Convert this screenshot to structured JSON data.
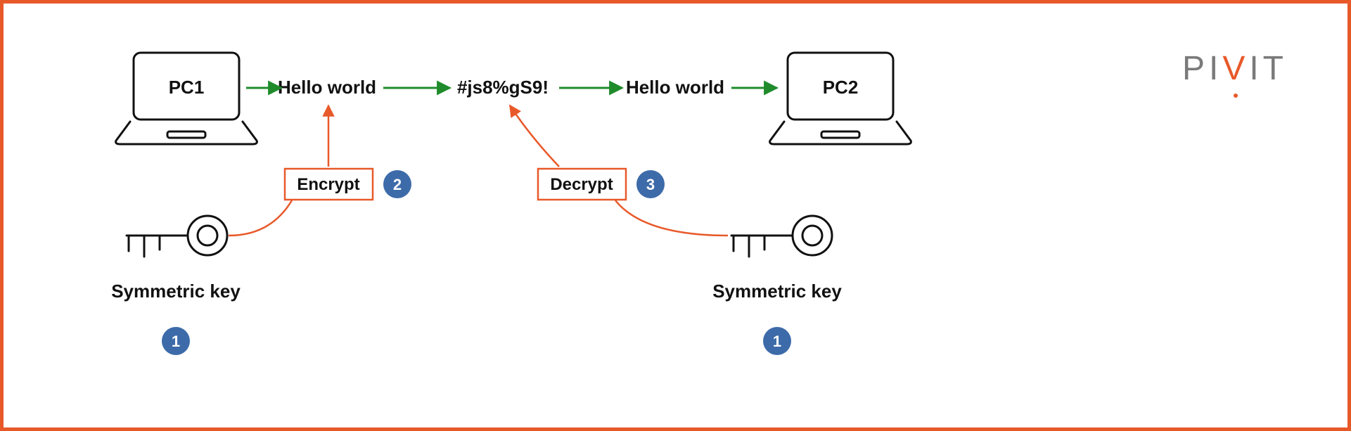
{
  "brand": {
    "p": "P",
    "i1": "I",
    "v": "V",
    "i2": "I",
    "t": "T"
  },
  "flow": {
    "pc1": "PC1",
    "plain1": "Hello world",
    "cipher": "#js8%gS9!",
    "plain2": "Hello world",
    "pc2": "PC2"
  },
  "boxes": {
    "encrypt": "Encrypt",
    "decrypt": "Decrypt"
  },
  "keys": {
    "left_label": "Symmetric key",
    "right_label": "Symmetric key"
  },
  "badges": {
    "key_left": "1",
    "encrypt": "2",
    "decrypt": "3",
    "key_right": "1"
  }
}
